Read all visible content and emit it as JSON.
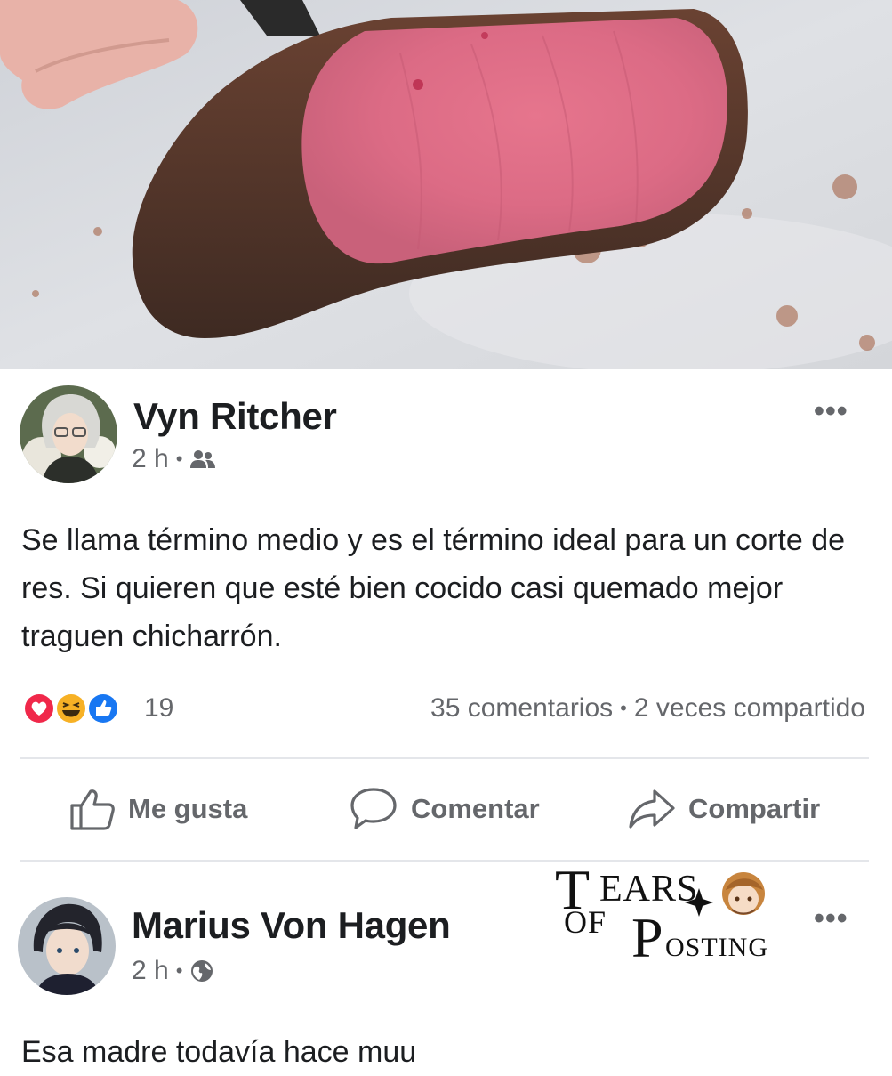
{
  "post": {
    "author": "Vyn Ritcher",
    "time": "2 h",
    "audience_icon": "friends-icon",
    "more_label": "•••",
    "text": "Se llama término medio y es el término ideal para un corte de res. Si quieren que esté bien cocido casi quemado mejor traguen chicharrón.",
    "reactions": {
      "types": [
        "love",
        "haha",
        "like"
      ],
      "count": "19"
    },
    "comments": "35 comentarios",
    "shares": "2 veces compartido",
    "separator": "•"
  },
  "actions": {
    "like": "Me gusta",
    "comment": "Comentar",
    "share": "Compartir"
  },
  "comment": {
    "author": "Marius Von Hagen",
    "time": "2 h",
    "audience_icon": "globe-icon",
    "more_label": "•••",
    "text": "Esa madre todavía hace muu"
  },
  "watermark": {
    "line1_initial": "T",
    "line1_rest": "EARS",
    "line2": "OF",
    "line3_initial": "P",
    "line3_rest": "OSTING"
  },
  "colors": {
    "love": "#f0284a",
    "haha": "#f7b125",
    "like": "#1877f2",
    "text_secondary": "#65676b"
  }
}
